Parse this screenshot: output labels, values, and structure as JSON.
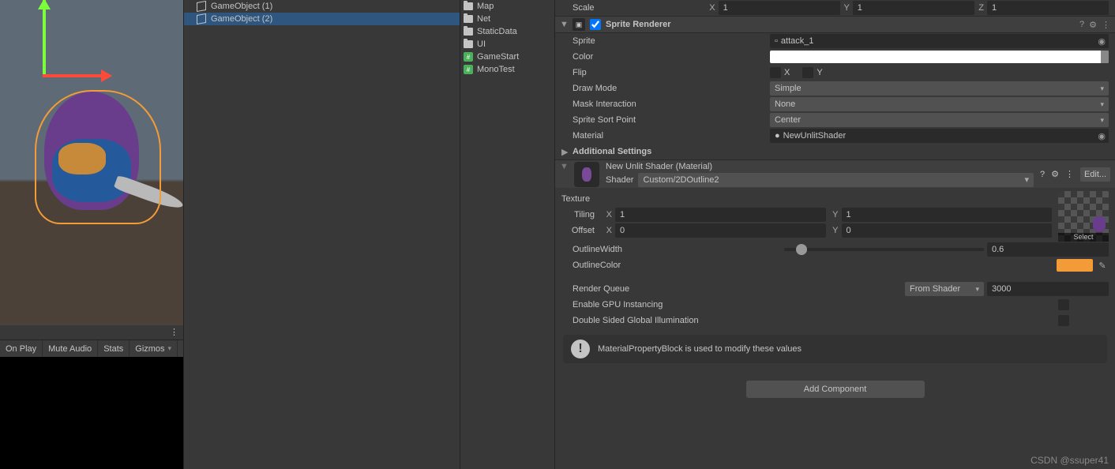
{
  "hierarchy": {
    "items": [
      {
        "name": "GameObject (1)",
        "dim": true,
        "selected": false
      },
      {
        "name": "GameObject (2)",
        "dim": false,
        "selected": true
      }
    ]
  },
  "project": {
    "items": [
      {
        "kind": "folder",
        "name": "Map"
      },
      {
        "kind": "folder",
        "name": "Net"
      },
      {
        "kind": "folder",
        "name": "StaticData"
      },
      {
        "kind": "folder",
        "name": "UI"
      },
      {
        "kind": "cs",
        "name": "GameStart"
      },
      {
        "kind": "cs",
        "name": "MonoTest"
      }
    ]
  },
  "scene_toolbar": {
    "on_play": "On Play",
    "mute": "Mute Audio",
    "stats": "Stats",
    "gizmos": "Gizmos"
  },
  "transform": {
    "scale_label": "Scale",
    "x": "1",
    "y": "1",
    "z": "1"
  },
  "sprite_renderer": {
    "title": "Sprite Renderer",
    "sprite_label": "Sprite",
    "sprite_value": "attack_1",
    "color_label": "Color",
    "color_value": "#FFFFFF",
    "flip_label": "Flip",
    "flip_x": "X",
    "flip_y": "Y",
    "draw_mode_label": "Draw Mode",
    "draw_mode_value": "Simple",
    "mask_label": "Mask Interaction",
    "mask_value": "None",
    "sort_label": "Sprite Sort Point",
    "sort_value": "Center",
    "material_label": "Material",
    "material_value": "NewUnlitShader",
    "additional": "Additional Settings"
  },
  "material": {
    "title": "New Unlit Shader (Material)",
    "shader_label": "Shader",
    "shader_value": "Custom/2DOutline2",
    "edit": "Edit...",
    "texture_label": "Texture",
    "tiling_label": "Tiling",
    "tiling_x": "1",
    "tiling_y": "1",
    "offset_label": "Offset",
    "offset_x": "0",
    "offset_y": "0",
    "outline_width_label": "OutlineWidth",
    "outline_width_value": "0.6",
    "outline_width_pct": 6,
    "outline_color_label": "OutlineColor",
    "outline_color_value": "#f39c37",
    "render_queue_label": "Render Queue",
    "render_queue_mode": "From Shader",
    "render_queue_value": "3000",
    "gpu_inst": "Enable GPU Instancing",
    "dsgi": "Double Sided Global Illumination",
    "select_label": "Select",
    "info": "MaterialPropertyBlock is used to modify these values"
  },
  "add_component": "Add Component",
  "watermark": "CSDN @ssuper41"
}
